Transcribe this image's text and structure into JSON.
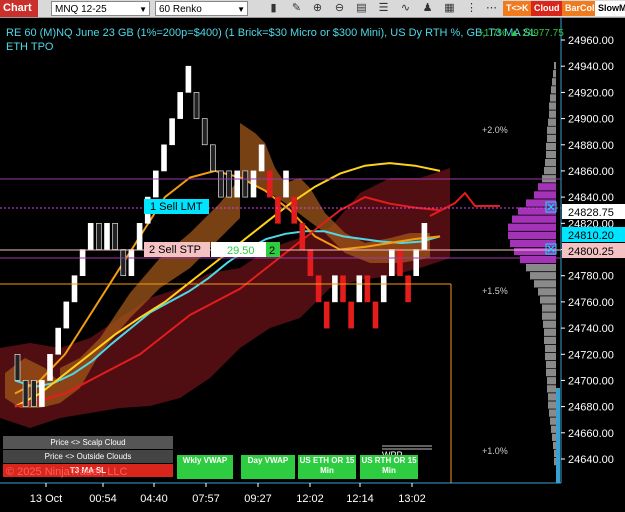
{
  "toolbar": {
    "chart_tab": "Chart",
    "instrument": "MNQ 12-25",
    "interval": "60 Renko",
    "icons": [
      "bars-icon",
      "draw-icon",
      "zoom-in-icon",
      "zoom-out-icon",
      "data-box-icon",
      "properties-icon",
      "indicators-icon",
      "strategies-icon",
      "templates-icon",
      "more-icon",
      "dots-icon"
    ],
    "pills": [
      {
        "label": "T<>K",
        "color": "#f07a1e"
      },
      {
        "label": "Cloud",
        "color": "#d9261c"
      },
      {
        "label": "BarCol",
        "color": "#f07a1e"
      },
      {
        "label": "SlowM",
        "color": "#ffffff"
      }
    ]
  },
  "header": {
    "line1": "RE 60 (M)NQ June 23 GB (1%=200p=$400) (1 Brick=$30 Micro or $300 Mini), US Dy RTH %, GB, T3 MA SL",
    "line2": "ETH TPO",
    "overlay": "+1.7% ▲ 24977.75"
  },
  "price_axis": {
    "ticks": [
      "24960.00",
      "24940.00",
      "24920.00",
      "24900.00",
      "24880.00",
      "24860.00",
      "24840.00",
      "24820.00",
      "24800.00",
      "24780.00",
      "24760.00",
      "24740.00",
      "24720.00",
      "24700.00",
      "24680.00",
      "24660.00",
      "24640.00"
    ],
    "markers": [
      {
        "label": "24828.75",
        "color": "#ffffff",
        "text_color": "#000000"
      },
      {
        "label": "24810.20",
        "color": "#00e5ff",
        "text_color": "#000000"
      },
      {
        "label": "24800.25",
        "color": "#f4c2c2",
        "text_color": "#000000"
      }
    ]
  },
  "time_axis": {
    "ticks": [
      "13 Oct",
      "00:54",
      "04:40",
      "07:57",
      "09:27",
      "12:02",
      "12:14",
      "13:02"
    ]
  },
  "percent_labels": [
    "+2.0%",
    "+1.5%",
    "+1.0%"
  ],
  "orders": {
    "sell_lmt": "1 Sell LMT",
    "sell_stp": "2 Sell STP",
    "stp_price": "29.50",
    "stp_qty": "2"
  },
  "controls": {
    "scalp_cloud": "Price <> Scalp Cloud",
    "outside_clouds": "Price <> Outside Clouds",
    "t3_ma_sl": "T3 MA SL",
    "copyright": "© 2025 NinjaTrader, LLC"
  },
  "vwap_buttons": [
    {
      "label": "Wkly VWAP"
    },
    {
      "label": "Day VWAP"
    },
    {
      "label": "US ETH OR 15 Min"
    },
    {
      "label": "US RTH OR 15 Min"
    }
  ],
  "wpp_label": "WPP",
  "chart_data": {
    "type": "line",
    "title": "RE 60 (M)NQ June 23 GB (1%=200p=$400) (1 Brick=$30 Micro or $300 Mini), US Dy RTH %, GB, T3 MA SL",
    "xlabel": "",
    "ylabel": "",
    "ylim": [
      24630,
      24975
    ],
    "x_ticks": [
      "13 Oct",
      "00:54",
      "04:40",
      "07:57",
      "09:27",
      "12:02",
      "12:14",
      "13:02"
    ],
    "renko_bricks": [
      {
        "i": 0,
        "o": 24720,
        "c": 24700,
        "up": false
      },
      {
        "i": 1,
        "o": 24700,
        "c": 24680,
        "up": false
      },
      {
        "i": 2,
        "o": 24700,
        "c": 24680,
        "up": false
      },
      {
        "i": 3,
        "o": 24680,
        "c": 24700,
        "up": true
      },
      {
        "i": 4,
        "o": 24700,
        "c": 24720,
        "up": true
      },
      {
        "i": 5,
        "o": 24720,
        "c": 24740,
        "up": true
      },
      {
        "i": 6,
        "o": 24740,
        "c": 24760,
        "up": true
      },
      {
        "i": 7,
        "o": 24760,
        "c": 24780,
        "up": true
      },
      {
        "i": 8,
        "o": 24780,
        "c": 24800,
        "up": true
      },
      {
        "i": 9,
        "o": 24800,
        "c": 24820,
        "up": true
      },
      {
        "i": 10,
        "o": 24820,
        "c": 24800,
        "up": false
      },
      {
        "i": 11,
        "o": 24800,
        "c": 24820,
        "up": true
      },
      {
        "i": 12,
        "o": 24820,
        "c": 24800,
        "up": false
      },
      {
        "i": 13,
        "o": 24800,
        "c": 24780,
        "up": false
      },
      {
        "i": 14,
        "o": 24780,
        "c": 24800,
        "up": true
      },
      {
        "i": 15,
        "o": 24800,
        "c": 24820,
        "up": true
      },
      {
        "i": 16,
        "o": 24820,
        "c": 24840,
        "up": true
      },
      {
        "i": 17,
        "o": 24840,
        "c": 24860,
        "up": true
      },
      {
        "i": 18,
        "o": 24860,
        "c": 24880,
        "up": true
      },
      {
        "i": 19,
        "o": 24880,
        "c": 24900,
        "up": true
      },
      {
        "i": 20,
        "o": 24900,
        "c": 24920,
        "up": true
      },
      {
        "i": 21,
        "o": 24920,
        "c": 24940,
        "up": true
      },
      {
        "i": 22,
        "o": 24920,
        "c": 24900,
        "up": false
      },
      {
        "i": 23,
        "o": 24900,
        "c": 24880,
        "up": false
      },
      {
        "i": 24,
        "o": 24880,
        "c": 24860,
        "up": false
      },
      {
        "i": 25,
        "o": 24860,
        "c": 24840,
        "up": false
      },
      {
        "i": 26,
        "o": 24860,
        "c": 24840,
        "up": false
      },
      {
        "i": 27,
        "o": 24840,
        "c": 24860,
        "up": true
      },
      {
        "i": 28,
        "o": 24860,
        "c": 24840,
        "up": false
      },
      {
        "i": 29,
        "o": 24840,
        "c": 24860,
        "up": true
      },
      {
        "i": 30,
        "o": 24860,
        "c": 24880,
        "up": true
      },
      {
        "i": 31,
        "o": 24860,
        "c": 24840,
        "up": false
      },
      {
        "i": 32,
        "o": 24840,
        "c": 24820,
        "up": false
      },
      {
        "i": 33,
        "o": 24840,
        "c": 24860,
        "up": true
      },
      {
        "i": 34,
        "o": 24840,
        "c": 24820,
        "up": false
      },
      {
        "i": 35,
        "o": 24820,
        "c": 24800,
        "up": false
      },
      {
        "i": 36,
        "o": 24800,
        "c": 24780,
        "up": false
      },
      {
        "i": 37,
        "o": 24780,
        "c": 24760,
        "up": false
      },
      {
        "i": 38,
        "o": 24760,
        "c": 24740,
        "up": false
      },
      {
        "i": 39,
        "o": 24760,
        "c": 24780,
        "up": true
      },
      {
        "i": 40,
        "o": 24780,
        "c": 24760,
        "up": false
      },
      {
        "i": 41,
        "o": 24760,
        "c": 24740,
        "up": false
      },
      {
        "i": 42,
        "o": 24760,
        "c": 24780,
        "up": true
      },
      {
        "i": 43,
        "o": 24780,
        "c": 24760,
        "up": false
      },
      {
        "i": 44,
        "o": 24760,
        "c": 24740,
        "up": false
      },
      {
        "i": 45,
        "o": 24760,
        "c": 24780,
        "up": true
      },
      {
        "i": 46,
        "o": 24780,
        "c": 24800,
        "up": true
      },
      {
        "i": 47,
        "o": 24800,
        "c": 24780,
        "up": false
      },
      {
        "i": 48,
        "o": 24780,
        "c": 24760,
        "up": false
      },
      {
        "i": 49,
        "o": 24780,
        "c": 24800,
        "up": true
      },
      {
        "i": 50,
        "o": 24800,
        "c": 24820,
        "up": true
      }
    ],
    "series": [
      {
        "name": "cyan",
        "color": "#4dd9e8",
        "values": [
          24700,
          24695,
          24698,
          24705,
          24715,
          24728,
          24740,
          24752,
          24760,
          24768,
          24778,
          24790,
          24800,
          24808,
          24812,
          24814,
          24814,
          24810,
          24808,
          24806,
          24805,
          24806,
          24810
        ]
      },
      {
        "name": "yellow",
        "color": "#ffd21a",
        "values": [
          24680,
          24690,
          24705,
          24720,
          24735,
          24748,
          24760,
          24775,
          24790,
          24805,
          24820,
          24835,
          24848,
          24858,
          24864,
          24866,
          24864,
          24860
        ]
      },
      {
        "name": "orange",
        "color": "#f39c12",
        "values": [
          24690,
          24700,
          24720,
          24750,
          24780,
          24810,
          24840,
          24855,
          24860,
          24855,
          24845,
          24830,
          24810,
          24800,
          24802,
          24805,
          24808,
          24810
        ]
      },
      {
        "name": "red",
        "color": "#e51c1c",
        "values": [
          24680,
          24685,
          24690,
          24700,
          24710,
          24720,
          24735,
          24750,
          24760,
          24770,
          24785,
          24800,
          24815,
          24830,
          24840,
          24835,
          24832,
          24830
        ]
      }
    ]
  }
}
